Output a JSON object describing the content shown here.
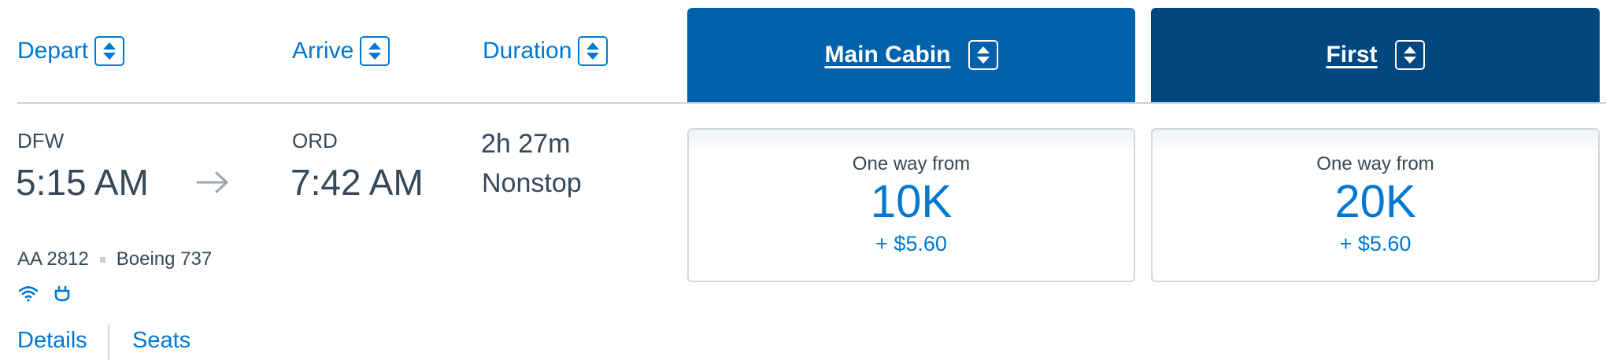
{
  "columns": {
    "depart": "Depart",
    "arrive": "Arrive",
    "duration": "Duration"
  },
  "cabins": [
    {
      "label": "Main Cabin",
      "color": "#0061ab"
    },
    {
      "label": "First",
      "color": "#00467f"
    }
  ],
  "flight": {
    "origin": "DFW",
    "depart_time": "5:15 AM",
    "destination": "ORD",
    "arrive_time": "7:42 AM",
    "duration": "2h 27m",
    "stops": "Nonstop",
    "flight_number": "AA 2812",
    "aircraft": "Boeing 737",
    "amenities": [
      "wifi-icon",
      "power-outlet-icon"
    ]
  },
  "fares": [
    {
      "label": "One way from",
      "miles": "10K",
      "tax": "+ $5.60"
    },
    {
      "label": "One way from",
      "miles": "20K",
      "tax": "+ $5.60"
    }
  ],
  "links": {
    "details": "Details",
    "seats": "Seats"
  },
  "colors": {
    "accent": "#0078d2",
    "text": "#36495a"
  }
}
